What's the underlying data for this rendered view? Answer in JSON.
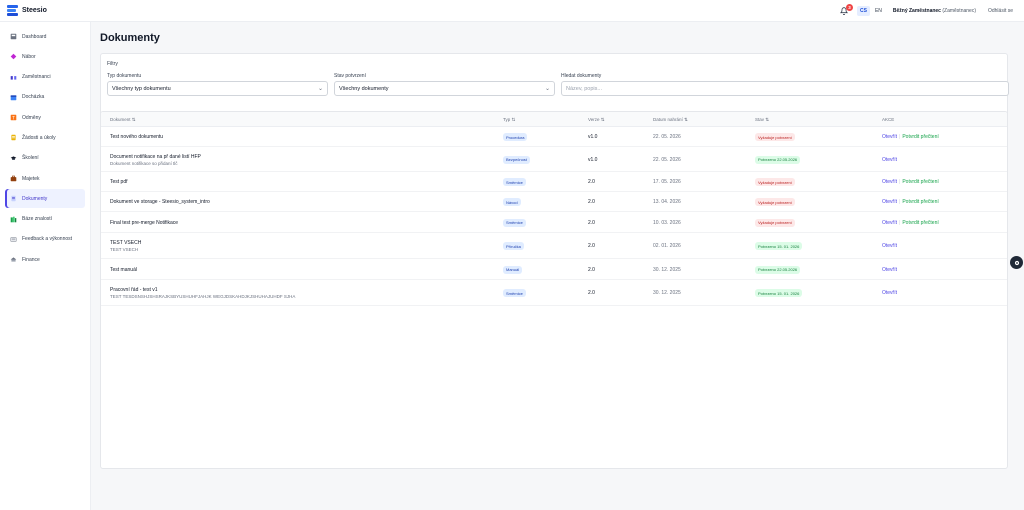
{
  "app": {
    "brand": "Steesio"
  },
  "topbar": {
    "notification_count": "3",
    "languages": [
      "CS",
      "EN"
    ],
    "active_language": "CS",
    "user_name": "Běžný Zaměstnanec",
    "user_role": "(Zaměstnanec)",
    "logout_label": "Odhlásit se"
  },
  "sidebar": {
    "items": [
      {
        "label": "Dashboard",
        "icon": "dashboard-icon",
        "active": false
      },
      {
        "label": "Nábor",
        "icon": "recruitment-icon",
        "active": false
      },
      {
        "label": "Zaměstnanci",
        "icon": "employees-icon",
        "active": false
      },
      {
        "label": "Docházka",
        "icon": "attendance-icon",
        "active": false
      },
      {
        "label": "Odměny",
        "icon": "rewards-icon",
        "active": false
      },
      {
        "label": "Žádosti a úkoly",
        "icon": "requests-icon",
        "active": false
      },
      {
        "label": "Školení",
        "icon": "training-icon",
        "active": false
      },
      {
        "label": "Majetek",
        "icon": "assets-icon",
        "active": false
      },
      {
        "label": "Dokumenty",
        "icon": "documents-icon",
        "active": true
      },
      {
        "label": "Báze znalostí",
        "icon": "knowledge-base-icon",
        "active": false
      },
      {
        "label": "Feedback a výkonnost",
        "icon": "feedback-icon",
        "active": false
      },
      {
        "label": "Finance",
        "icon": "finance-icon",
        "active": false
      }
    ]
  },
  "page": {
    "title": "Dokumenty"
  },
  "filters": {
    "title": "Filtry",
    "type_label": "Typ dokumentu",
    "type_value": "Všechny typ dokumentu",
    "status_label": "Stav potvrzení",
    "status_value": "Všechny dokumenty",
    "search_label": "Hledat dokumenty",
    "search_placeholder": "Název, popis..."
  },
  "table": {
    "headers": {
      "document": "Dokument ⇅",
      "type": "Typ ⇅",
      "version": "Verze ⇅",
      "date": "Datum nahrání ⇅",
      "status": "Stav ⇅",
      "actions": "AKCE"
    },
    "rows": [
      {
        "name": "Test nového dokumentu",
        "desc": "",
        "type": "Procedura",
        "version": "v1.0",
        "date": "22. 05. 2026",
        "status": "Vyžaduje potvrzení",
        "status_kind": "red",
        "open": "Otevřít",
        "confirm": "Potvrdit přečtení"
      },
      {
        "name": "Document notifikace na př dané listí HFP",
        "desc": "Dokument notifikace so přidaní tlč",
        "type": "Bezpečnost",
        "version": "v1.0",
        "date": "22. 05. 2026",
        "status": "Potvrzeno 22.05.2026",
        "status_kind": "green",
        "open": "Otevřít",
        "confirm": ""
      },
      {
        "name": "Test pdf",
        "desc": "",
        "type": "Směrnice",
        "version": "2.0",
        "date": "17. 05. 2026",
        "status": "Vyžaduje potvrzení",
        "status_kind": "red",
        "open": "Otevřít",
        "confirm": "Potvrdit přečtení"
      },
      {
        "name": "Dokument ve storage - Steesio_system_intro",
        "desc": "",
        "type": "Návod",
        "version": "2.0",
        "date": "13. 04. 2026",
        "status": "Vyžaduje potvrzení",
        "status_kind": "red",
        "open": "Otevřít",
        "confirm": "Potvrdit přečtení"
      },
      {
        "name": "Final test pre-merge Notifikace",
        "desc": "",
        "type": "Směrnice",
        "version": "2.0",
        "date": "10. 03. 2026",
        "status": "Vyžaduje potvrzení",
        "status_kind": "red",
        "open": "Otevřít",
        "confirm": "Potvrdit přečtení"
      },
      {
        "name": "TEST VSECH",
        "desc": "TEST VSECH",
        "type": "Příručka",
        "version": "2.0",
        "date": "02. 01. 2026",
        "status": "Potvrzeno 15. 01. 2026",
        "status_kind": "green",
        "open": "Otevřít",
        "confirm": ""
      },
      {
        "name": "Test manuál",
        "desc": "",
        "type": "Manuál",
        "version": "2.0",
        "date": "30. 12. 2025",
        "status": "Potvrzeno 22.05.2026",
        "status_kind": "green",
        "open": "Otevřít",
        "confirm": ""
      },
      {
        "name": "Pracovní řád - test v1",
        "desc": "TEST TESDSNSHJSHSRAJKSBYUSHUHFJAHJK WEGJDSKAHDJKJSHUHAJUHDF SJHA",
        "type": "Směrnice",
        "version": "2.0",
        "date": "30. 12. 2025",
        "status": "Potvrzeno 15. 01. 2026",
        "status_kind": "green",
        "open": "Otevřít",
        "confirm": ""
      }
    ]
  }
}
